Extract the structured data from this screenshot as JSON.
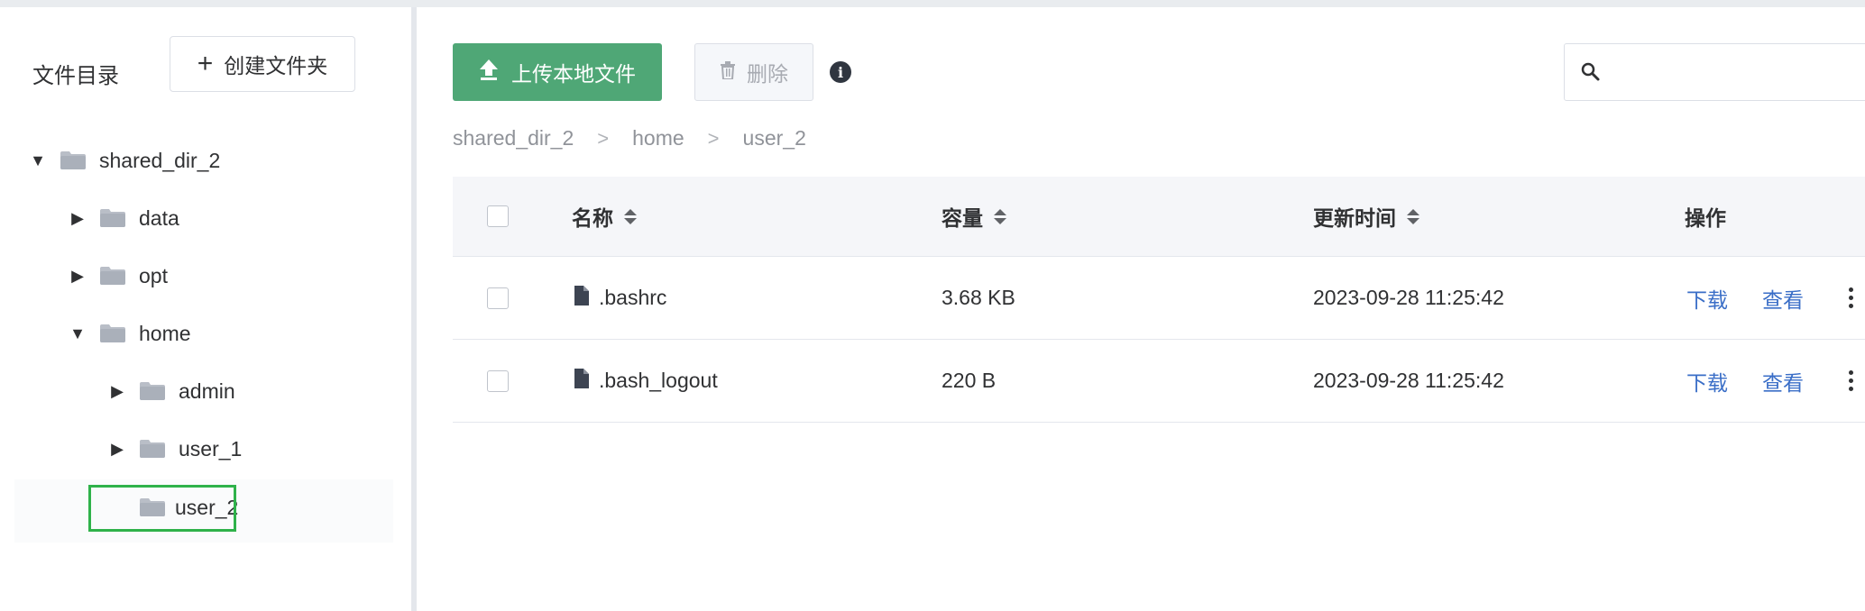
{
  "sidebar": {
    "title": "文件目录",
    "create_folder_label": "创建文件夹",
    "tree": [
      {
        "label": "shared_dir_2",
        "expanded": true,
        "caret": "▼"
      },
      {
        "label": "data",
        "expanded": false,
        "caret": "▶"
      },
      {
        "label": "opt",
        "expanded": false,
        "caret": "▶"
      },
      {
        "label": "home",
        "expanded": true,
        "caret": "▼"
      },
      {
        "label": "admin",
        "expanded": false,
        "caret": "▶"
      },
      {
        "label": "user_1",
        "expanded": false,
        "caret": "▶"
      },
      {
        "label": "user_2",
        "selected": true,
        "caret": ""
      }
    ]
  },
  "toolbar": {
    "upload_label": "上传本地文件",
    "delete_label": "删除",
    "info_symbol": "i",
    "search_value": "",
    "search_placeholder": ""
  },
  "breadcrumb": [
    "shared_dir_2",
    "home",
    "user_2"
  ],
  "table": {
    "columns": [
      "名称",
      "容量",
      "更新时间",
      "操作"
    ],
    "rows": [
      {
        "name": ".bashrc",
        "size": "3.68 KB",
        "updated": "2023-09-28 11:25:42",
        "actions": [
          "下载",
          "查看"
        ]
      },
      {
        "name": ".bash_logout",
        "size": "220 B",
        "updated": "2023-09-28 11:25:42",
        "actions": [
          "下载",
          "查看"
        ]
      }
    ]
  },
  "colors": {
    "primary_green": "#4fa776",
    "selection_outline": "#2fb24a",
    "link_blue": "#3a6ec7"
  },
  "icons": [
    "plus-icon",
    "folder-icon",
    "upload-icon",
    "trash-icon",
    "info-icon",
    "search-icon",
    "file-icon",
    "sort-icon",
    "more-icon",
    "caret-icon"
  ]
}
